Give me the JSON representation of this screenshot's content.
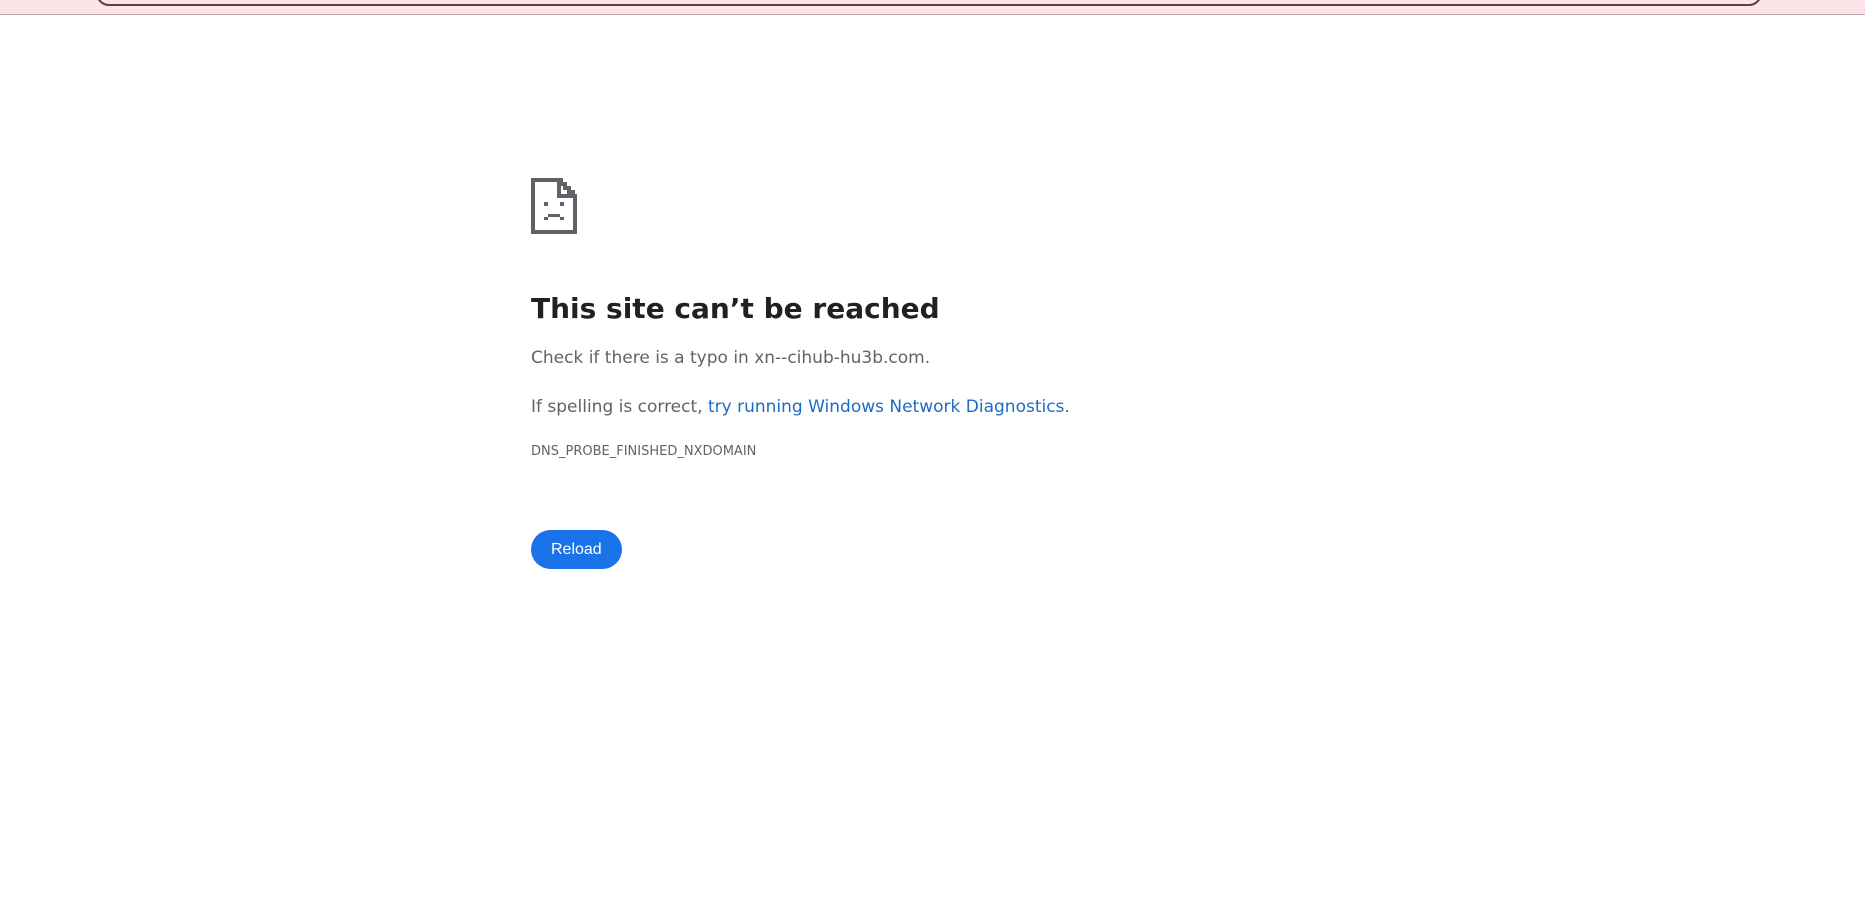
{
  "page": {
    "title": "This site can’t be reached",
    "typo_text": "Check if there is a typo in xn--cihub-hu3b.com.",
    "spelling_prefix": "If spelling is correct, ",
    "diagnostics_link": "try running Windows Network Diagnostics",
    "spelling_suffix": ".",
    "error_code": "DNS_PROBE_FINISHED_NXDOMAIN",
    "reload_label": "Reload"
  },
  "icons": {
    "error": "sad-document-icon"
  },
  "colors": {
    "accent": "#1a73e8",
    "link": "#1e6bc4",
    "heading": "#202124",
    "body_text": "#5f6368",
    "top_strip": "#fbe4e8"
  }
}
